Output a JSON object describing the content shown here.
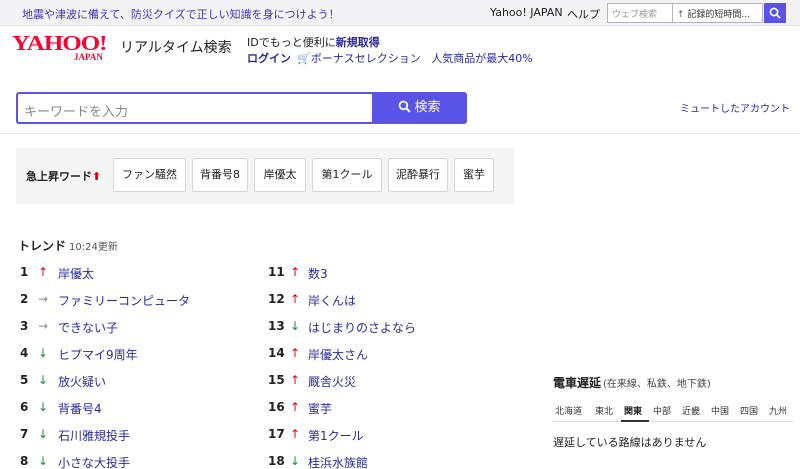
{
  "topbar": {
    "notice": "地震や津波に備えて、防災クイズで正しい知識を身につけよう！",
    "yahoo_japan": "Yahoo! JAPAN",
    "help": "ヘルプ",
    "web_search_placeholder": "ウェブ検索",
    "trend_box_text": "記録的短時間..."
  },
  "header": {
    "logo_text": "YAHOO!",
    "logo_sub": "JAPAN",
    "service_name": "リアルタイム検索",
    "promo_line1_prefix": "IDでもっと便利に",
    "promo_line1_link": "新規取得",
    "login": "ログイン",
    "bonus": "ボーナスセレクション",
    "popular": "人気商品が最大40%"
  },
  "search": {
    "placeholder": "キーワードを入力",
    "button": "検索"
  },
  "mute_link": "ミュートしたアカウント",
  "rising": {
    "title": "急上昇ワード",
    "words": [
      "ファン騒然",
      "背番号8",
      "岸優太",
      "第1クール",
      "泥酔暴行",
      "蜜芋"
    ]
  },
  "trend": {
    "title": "トレンド",
    "updated": "10:24更新",
    "items": [
      {
        "rank": "1",
        "dir": "up",
        "keyword": "岸優太"
      },
      {
        "rank": "2",
        "dir": "flat",
        "keyword": "ファミリーコンピュータ"
      },
      {
        "rank": "3",
        "dir": "flat",
        "keyword": "できない子"
      },
      {
        "rank": "4",
        "dir": "down",
        "keyword": "ヒプマイ9周年"
      },
      {
        "rank": "5",
        "dir": "down",
        "keyword": "放火疑い"
      },
      {
        "rank": "6",
        "dir": "down",
        "keyword": "背番号4"
      },
      {
        "rank": "7",
        "dir": "down",
        "keyword": "石川雅規投手"
      },
      {
        "rank": "8",
        "dir": "down",
        "keyword": "小さな大投手"
      },
      {
        "rank": "11",
        "dir": "up",
        "keyword": "数3"
      },
      {
        "rank": "12",
        "dir": "up",
        "keyword": "岸くんは"
      },
      {
        "rank": "13",
        "dir": "down",
        "keyword": "はじまりのさよなら"
      },
      {
        "rank": "14",
        "dir": "up",
        "keyword": "岸優太さん"
      },
      {
        "rank": "15",
        "dir": "up",
        "keyword": "厩舎火災"
      },
      {
        "rank": "16",
        "dir": "up",
        "keyword": "蜜芋"
      },
      {
        "rank": "17",
        "dir": "up",
        "keyword": "第1クール"
      },
      {
        "rank": "18",
        "dir": "down",
        "keyword": "桂浜水族館"
      }
    ]
  },
  "train": {
    "title": "電車遅延",
    "subtitle": "(在来線、私鉄、地下鉄)",
    "tabs": [
      "北海道",
      "東北",
      "関東",
      "中部",
      "近畿",
      "中国",
      "四国",
      "九州"
    ],
    "active_tab": "関東",
    "message": "遅延している路線はありません"
  },
  "colors": {
    "accent": "#5a53e8",
    "brand": "#ff0033",
    "link": "#2a2aa0",
    "up": "#e60012",
    "down": "#1e8a3a"
  }
}
